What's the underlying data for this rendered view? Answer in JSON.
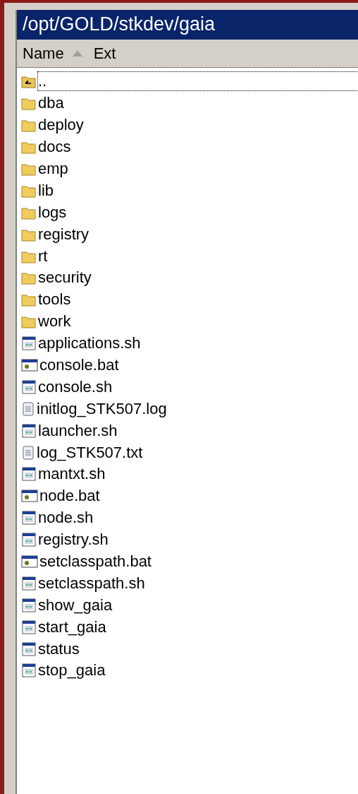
{
  "title": "/opt/GOLD/stkdev/gaia",
  "columns": [
    {
      "label": "Name",
      "sorted": true
    },
    {
      "label": "Ext",
      "sorted": false
    }
  ],
  "items": [
    {
      "name": "..",
      "kind": "up",
      "focused": true
    },
    {
      "name": "dba",
      "kind": "folder",
      "focused": false
    },
    {
      "name": "deploy",
      "kind": "folder",
      "focused": false
    },
    {
      "name": "docs",
      "kind": "folder",
      "focused": false
    },
    {
      "name": "emp",
      "kind": "folder",
      "focused": false
    },
    {
      "name": "lib",
      "kind": "folder",
      "focused": false
    },
    {
      "name": "logs",
      "kind": "folder",
      "focused": false
    },
    {
      "name": "registry",
      "kind": "folder",
      "focused": false
    },
    {
      "name": "rt",
      "kind": "folder",
      "focused": false
    },
    {
      "name": "security",
      "kind": "folder",
      "focused": false
    },
    {
      "name": "tools",
      "kind": "folder",
      "focused": false
    },
    {
      "name": "work",
      "kind": "folder",
      "focused": false
    },
    {
      "name": "applications.sh",
      "kind": "script",
      "focused": false
    },
    {
      "name": "console.bat",
      "kind": "batch",
      "focused": false
    },
    {
      "name": "console.sh",
      "kind": "script",
      "focused": false
    },
    {
      "name": "initlog_STK507.log",
      "kind": "text",
      "focused": false
    },
    {
      "name": "launcher.sh",
      "kind": "script",
      "focused": false
    },
    {
      "name": "log_STK507.txt",
      "kind": "text",
      "focused": false
    },
    {
      "name": "mantxt.sh",
      "kind": "script",
      "focused": false
    },
    {
      "name": "node.bat",
      "kind": "batch",
      "focused": false
    },
    {
      "name": "node.sh",
      "kind": "script",
      "focused": false
    },
    {
      "name": "registry.sh",
      "kind": "script",
      "focused": false
    },
    {
      "name": "setclasspath.bat",
      "kind": "batch",
      "focused": false
    },
    {
      "name": "setclasspath.sh",
      "kind": "script",
      "focused": false
    },
    {
      "name": "show_gaia",
      "kind": "script",
      "focused": false
    },
    {
      "name": "start_gaia",
      "kind": "script",
      "focused": false
    },
    {
      "name": "status",
      "kind": "script",
      "focused": false
    },
    {
      "name": "stop_gaia",
      "kind": "script",
      "focused": false
    }
  ]
}
